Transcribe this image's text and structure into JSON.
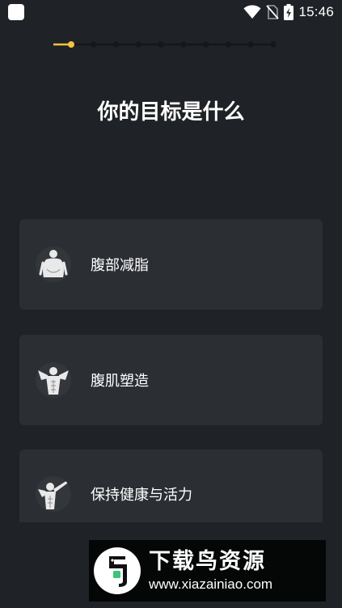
{
  "status_bar": {
    "time": "15:46",
    "icons": [
      "app-indicator-icon",
      "wifi-icon",
      "no-sim-icon",
      "battery-charging-icon"
    ]
  },
  "stepper": {
    "total_steps": 10,
    "current_step": 1,
    "active_color": "#f5c242",
    "inactive_color": "#15171a"
  },
  "title": "你的目标是什么",
  "options": [
    {
      "label": "腹部减脂",
      "icon": "belly-figure-icon"
    },
    {
      "label": "腹肌塑造",
      "icon": "muscle-figure-icon"
    },
    {
      "label": "保持健康与活力",
      "icon": "flex-pose-icon"
    }
  ],
  "watermark": {
    "title": "下载鸟资源",
    "url": "www.xiazainiao.com",
    "logo": "bird-logo-icon"
  },
  "colors": {
    "background": "#1f2226",
    "card": "#2b2e33",
    "accent": "#f5c242",
    "text": "#ffffff"
  }
}
